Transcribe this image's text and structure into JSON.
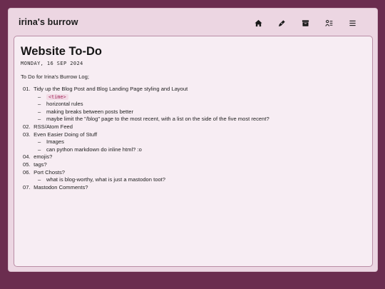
{
  "site": {
    "title": "irina's burrow"
  },
  "nav": [
    {
      "icon": "home-icon"
    },
    {
      "icon": "pen-icon"
    },
    {
      "icon": "archive-icon"
    },
    {
      "icon": "user-list-icon"
    },
    {
      "icon": "menu-icon"
    }
  ],
  "post": {
    "title": "Website To-Do",
    "date": "MONDAY, 16 SEP 2024",
    "intro": "To Do for Irina's Burrow Log;",
    "items": [
      {
        "num": "01.",
        "text": "Tidy up the Blog Post and Blog Landing Page styling and Layout",
        "subs": [
          {
            "code": "<time>"
          },
          {
            "text": "horizontal rules"
          },
          {
            "text": "making breaks between posts better"
          },
          {
            "text": "maybe limit the \"/blog\" page to the most recent, with a list on the side of the five most recent?"
          }
        ]
      },
      {
        "num": "02.",
        "text": "RSS/Atom Feed",
        "subs": []
      },
      {
        "num": "03.",
        "text": "Even Easier Doing of Stuff",
        "subs": [
          {
            "text": "Images"
          },
          {
            "text": "can python markdown do inline html? :o"
          }
        ]
      },
      {
        "num": "04.",
        "text": "emojis?",
        "subs": []
      },
      {
        "num": "05.",
        "text": "tags?",
        "subs": []
      },
      {
        "num": "06.",
        "text": "Port Chosts?",
        "subs": [
          {
            "text": "what is blog-worthy, what is just a mastodon toot?"
          }
        ]
      },
      {
        "num": "07.",
        "text": "Mastodon Comments?",
        "subs": []
      }
    ]
  },
  "colors": {
    "background": "#6b2d4f",
    "window": "#ecd6e2",
    "card": "#f7edf3",
    "code_text": "#a3265a"
  }
}
